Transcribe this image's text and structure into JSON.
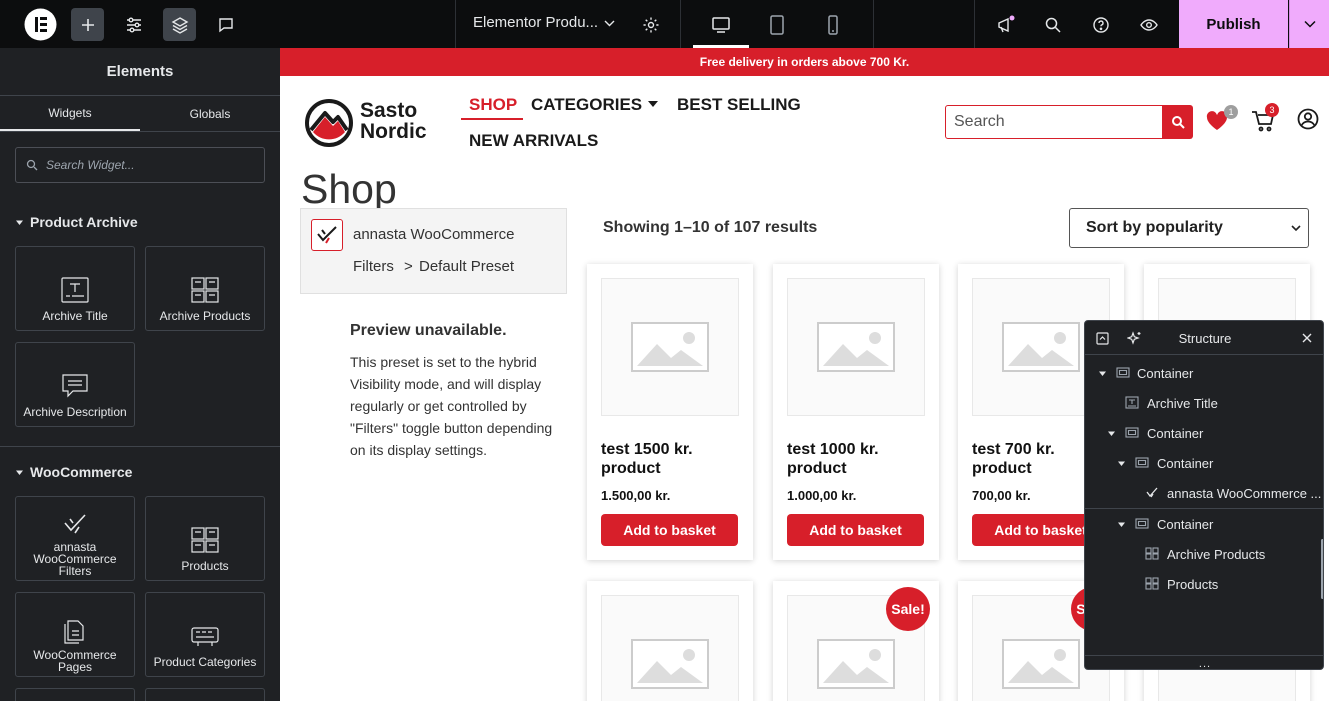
{
  "topbar": {
    "document_title": "Elementor Produ...",
    "publish_label": "Publish"
  },
  "panel": {
    "title": "Elements",
    "tabs": [
      "Widgets",
      "Globals"
    ],
    "search_placeholder": "Search Widget...",
    "categories": [
      {
        "name": "Product Archive",
        "widgets": [
          {
            "label": "Archive Title",
            "icon": "archive-title-icon"
          },
          {
            "label": "Archive Products",
            "icon": "archive-products-icon"
          },
          {
            "label": "Archive Description",
            "icon": "archive-description-icon"
          }
        ]
      },
      {
        "name": "WooCommerce",
        "widgets": [
          {
            "label": "annasta WooCommerce Filters",
            "icon": "annasta-filters-icon"
          },
          {
            "label": "Products",
            "icon": "products-icon"
          },
          {
            "label": "WooCommerce Pages",
            "icon": "woocommerce-pages-icon"
          },
          {
            "label": "Product Categories",
            "icon": "product-categories-icon"
          }
        ]
      }
    ]
  },
  "site": {
    "promo": "Free delivery in orders above 700 Kr.",
    "logo_line1": "Sasto",
    "logo_line2": "Nordic",
    "nav": [
      "SHOP",
      "CATEGORIES",
      "BEST SELLING",
      "NEW ARRIVALS"
    ],
    "search_placeholder": "Search",
    "wishlist_count": "1",
    "cart_count": "3",
    "page_title": "Shop",
    "filter_widget": {
      "title": "annasta WooCommerce",
      "path1": "Filters",
      "sep": ">",
      "path2": "Default Preset"
    },
    "preview_heading": "Preview unavailable.",
    "preview_text": "This preset is set to the hybrid Visibility mode, and will display regularly or get controlled by \"Filters\" toggle button depending on its display settings.",
    "result_count": "Showing 1–10 of 107 results",
    "sort_selected": "Sort by popularity",
    "products": [
      {
        "name": "test 1500 kr. product",
        "price": "1.500,00 kr.",
        "button": "Add to basket"
      },
      {
        "name": "test 1000 kr. product",
        "price": "1.000,00 kr.",
        "button": "Add to basket"
      },
      {
        "name": "test 700 kr. product",
        "price": "700,00 kr.",
        "button": "Add to basket"
      }
    ],
    "sale_badge": "Sale!",
    "accent_color": "#d71f2a"
  },
  "structure": {
    "title": "Structure",
    "items": [
      {
        "label": "Container",
        "depth": 0,
        "expandable": true,
        "icon": "container-icon"
      },
      {
        "label": "Archive Title",
        "depth": 1,
        "expandable": false,
        "icon": "archive-title-icon"
      },
      {
        "label": "Container",
        "depth": 1,
        "expandable": true,
        "icon": "container-icon"
      },
      {
        "label": "Container",
        "depth": 2,
        "expandable": true,
        "icon": "container-icon"
      },
      {
        "label": "annasta WooCommerce ...",
        "depth": 3,
        "expandable": false,
        "icon": "annasta-filters-icon"
      },
      {
        "label": "Container",
        "depth": 2,
        "expandable": true,
        "icon": "container-icon"
      },
      {
        "label": "Archive Products",
        "depth": 3,
        "expandable": false,
        "icon": "archive-products-icon"
      },
      {
        "label": "Products",
        "depth": 3,
        "expandable": false,
        "icon": "products-icon"
      }
    ],
    "footer": "..."
  },
  "colors": {
    "topbar_bg": "#0c0d0e",
    "panel_bg": "#1f2124",
    "publish_bg": "#f0abfc",
    "accent": "#d71f2a"
  }
}
